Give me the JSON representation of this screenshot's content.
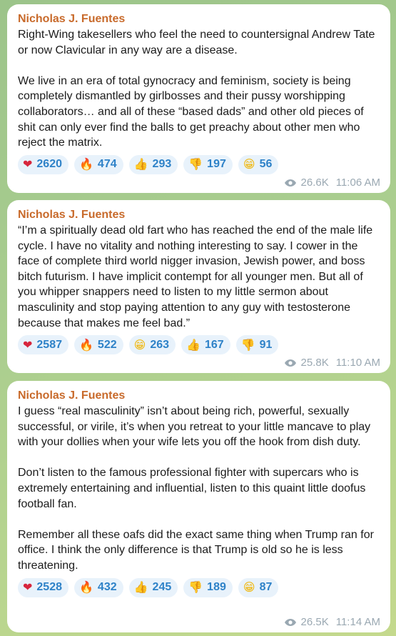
{
  "messages": [
    {
      "author": "Nicholas J. Fuentes",
      "text": "Right-Wing takesellers who feel the need to countersignal Andrew Tate or now Clavicular in any way are a disease.\n\nWe live in an era of total gynocracy and feminism, society is being completely dismantled by girlbosses and their pussy worshipping collaborators… and all of these “based dads” and other old pieces of shit can only ever find the balls to get preachy about other men who reject the matrix.",
      "reactions": [
        {
          "emoji": "heart",
          "count": "2620"
        },
        {
          "emoji": "fire",
          "count": "474"
        },
        {
          "emoji": "thumbs-up",
          "count": "293"
        },
        {
          "emoji": "thumbs-down",
          "count": "197"
        },
        {
          "emoji": "grin",
          "count": "56"
        }
      ],
      "views": "26.6K",
      "time": "11:06 AM"
    },
    {
      "author": "Nicholas J. Fuentes",
      "text": "“I’m a spiritually dead old fart who has reached the end of the male life cycle. I have no vitality and nothing interesting to say. I cower in the face of complete third world nigger invasion, Jewish power, and boss bitch futurism. I have implicit contempt for all younger men. But all of you whipper snappers need to listen to my little sermon about masculinity and stop paying attention to any guy with testosterone because that makes me feel bad.”",
      "reactions": [
        {
          "emoji": "heart",
          "count": "2587"
        },
        {
          "emoji": "fire",
          "count": "522"
        },
        {
          "emoji": "grin",
          "count": "263"
        },
        {
          "emoji": "thumbs-up",
          "count": "167"
        },
        {
          "emoji": "thumbs-down",
          "count": "91"
        }
      ],
      "views": "25.8K",
      "time": "11:10 AM"
    },
    {
      "author": "Nicholas J. Fuentes",
      "text": "I guess “real masculinity” isn’t about being rich, powerful, sexually successful, or virile, it’s when you retreat to your little mancave to play with your dollies when your wife lets you off the hook from dish duty.\n\nDon’t listen to the famous professional fighter with supercars who is extremely entertaining and influential, listen to this quaint little doofus football fan.\n\nRemember all these oafs did the exact same thing when Trump ran for office. I think the only difference is that Trump is old so he is less threatening.",
      "reactions": [
        {
          "emoji": "heart",
          "count": "2528"
        },
        {
          "emoji": "fire",
          "count": "432"
        },
        {
          "emoji": "thumbs-up",
          "count": "245"
        },
        {
          "emoji": "thumbs-down",
          "count": "189"
        },
        {
          "emoji": "grin",
          "count": "87"
        }
      ],
      "views": "26.5K",
      "time": "11:14 AM"
    }
  ],
  "colors": {
    "author": "#c86a2b",
    "reaction_text": "#2e82c8",
    "reaction_bg": "#e8f2fb",
    "meta_text": "#9aa8b2"
  }
}
